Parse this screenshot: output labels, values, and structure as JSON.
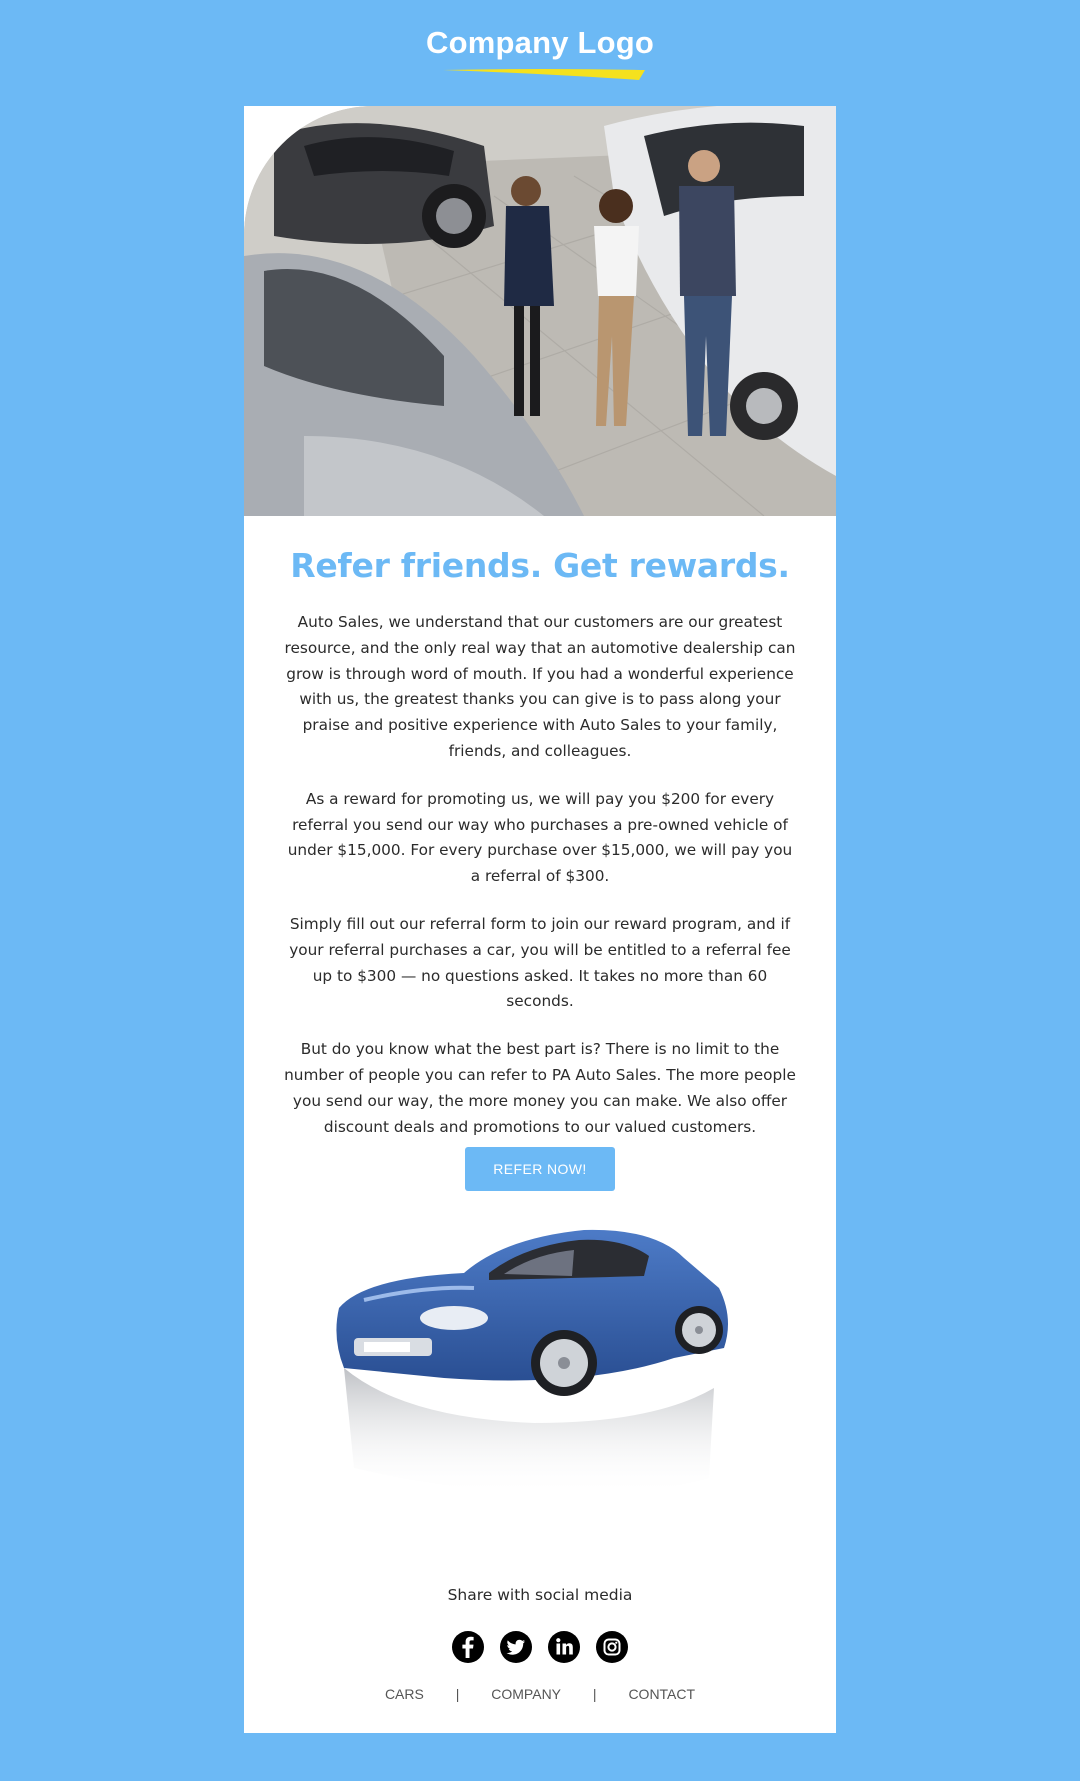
{
  "header": {
    "logo_text": "Company Logo"
  },
  "hero": {
    "image_name": "car-dealership-showroom-photo"
  },
  "content": {
    "headline": "Refer friends. Get rewards.",
    "paragraphs": [
      "Auto Sales, we understand that our customers are our greatest resource, and the only real way that an automotive dealership can grow is through word of mouth. If you had a wonderful experience with us, the greatest thanks you can give is to pass along your praise and positive experience with Auto Sales to your family, friends, and colleagues.",
      "As a reward for promoting us, we will pay you $200 for every referral you send our way who purchases a pre-owned vehicle of under $15,000. For every purchase over $15,000, we will pay you a referral of $300.",
      "Simply fill out our referral form to join our reward program, and if your referral purchases a car, you will be entitled to a referral fee up to $300 — no questions asked. It takes no more than 60 seconds.",
      "But do you know what the best part is? There is no limit to the number of people you can refer to PA Auto Sales. The more people you send our way, the more money you can make. We also offer discount deals and promotions to our valued customers."
    ],
    "cta_label": "REFER NOW!"
  },
  "footer": {
    "share_label": "Share with social media",
    "social": [
      {
        "name": "facebook-icon"
      },
      {
        "name": "twitter-icon"
      },
      {
        "name": "linkedin-icon"
      },
      {
        "name": "instagram-icon"
      }
    ],
    "nav": [
      "CARS",
      "COMPANY",
      "CONTACT"
    ],
    "separator": "|"
  },
  "colors": {
    "background": "#6cb9f5",
    "accent": "#6cb9f5",
    "swoosh": "#f5e11e",
    "card": "#ffffff",
    "text": "#2b2b2b"
  }
}
